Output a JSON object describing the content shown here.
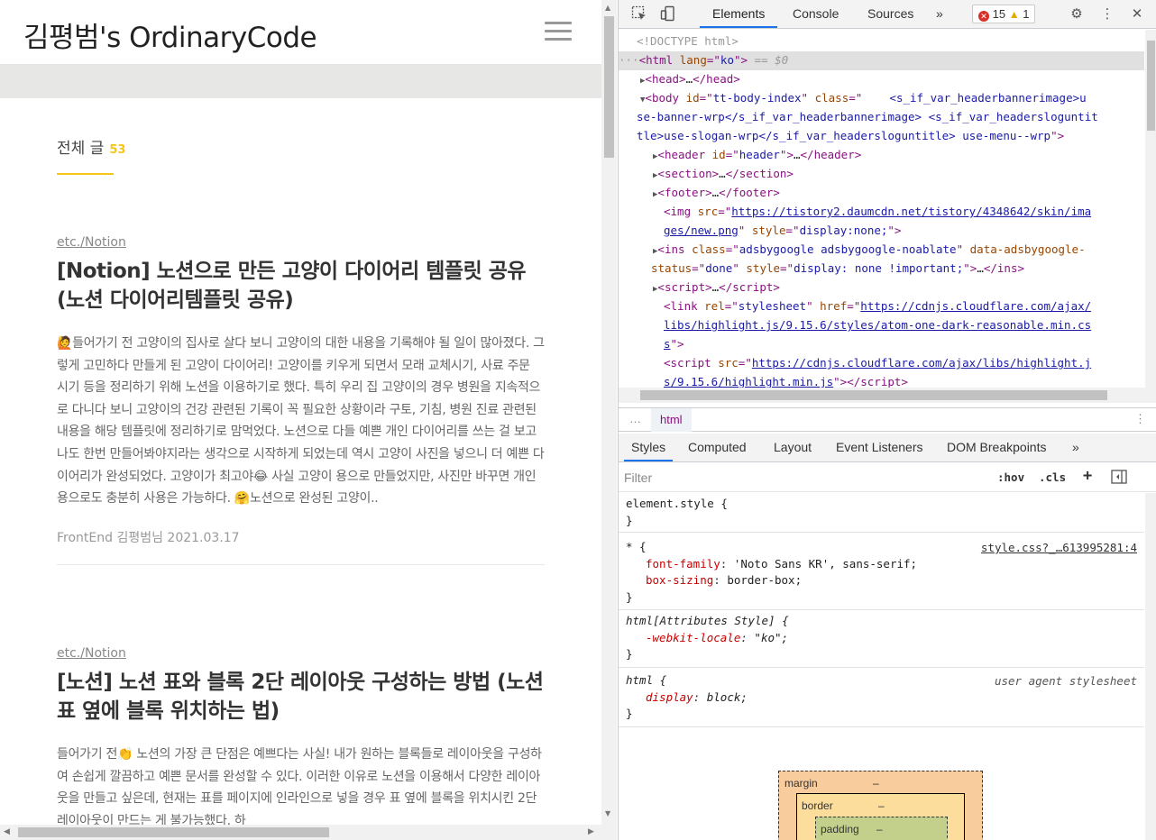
{
  "blog": {
    "title": "김평범's OrdinaryCode",
    "category_heading": "전체 글",
    "category_count": "53",
    "posts": [
      {
        "category": "etc./Notion",
        "title": "[Notion] 노션으로 만든 고양이 다이어리 템플릿 공유 (노션 다이어리템플릿 공유)",
        "body": "들어가기 전 고양이의 집사로 살다 보니 고양이의 대한 내용을 기록해야 될 일이 많아졌다. 그렇게 고민하다 만들게 된 고양이 다이어리! 고양이를 키우게 되면서 모래 교체시기, 사료 주문 시기 등을 정리하기 위해 노션을 이용하기로 했다. 특히 우리 집 고양이의 경우 병원을 지속적으로 다니다 보니 고양이의 건강 관련된 기록이 꼭 필요한 상황이라 구토, 기침, 병원 진료 관련된 내용을 해당 템플릿에 정리하기로 맘먹었다. 노션으로 다들 예쁜 개인 다이어리를 쓰는 걸 보고 나도 한번 만들어봐야지라는 생각으로 시작하게 되었는데 역시 고양이 사진을 넣으니 더 예쁜 다이어리가 완성되었다. 고양이가 최고야",
        "body_tail": " 사실 고양이 용으로 만들었지만, 사진만 바꾸면 개인용으로도 충분히 사용은 가능하다. ",
        "body_end": "노션으로 완성된 고양이..",
        "meta": "FrontEnd 김평범님 2021.03.17"
      },
      {
        "category": "etc./Notion",
        "title": "[노션] 노션 표와 블록 2단 레이아웃 구성하는 방법 (노션 표 옆에 블록 위치하는 법)",
        "body_start": "들어가기 전",
        "body": " 노션의 가장 큰 단점은 예쁘다는 사실! 내가 원하는 블록들로 레이아웃을 구성하여 손쉽게 깔끔하고 예쁜 문서를 완성할 수 있다. 이러한 이유로 노션을 이용해서 다양한 레이아웃을 만들고 싶은데, 현재는 표를 페이지에 인라인으로 넣을 경우 표 옆에 블록을 위치시킨 2단 레이아웃이 만드는 게 불가능했다. 하"
      }
    ]
  },
  "devtools": {
    "tabs": [
      "Elements",
      "Console",
      "Sources"
    ],
    "more_tabs": "»",
    "errors": "15",
    "warnings": "1",
    "dom": {
      "doctype": "<!DOCTYPE html>",
      "html_open": "html",
      "html_attr": "lang",
      "html_val": "ko",
      "html_suffix": " == $0",
      "head": "head",
      "body_id": "tt-body-index",
      "body_class_1": "    <s_if_var_headerbannerimage>u",
      "body_class_2": "se-banner-wrp</s_if_var_headerbannerimage> <s_if_var_headersloguntit",
      "body_class_3": "tle>use-slogan-wrp</s_if_var_headersloguntitle> use-menu--wrp",
      "header_id": "header",
      "img_src_1": "https://tistory2.daumcdn.net/tistory/4348642/skin/ima",
      "img_src_2": "ges/new.png",
      "img_style": "display:none;",
      "ins_class": "adsbygoogle adsbygoogle-noablate",
      "ins_attr": "data-adsbygoogle-",
      "ins_attr_2": "status",
      "ins_status": "done",
      "ins_style": "display: none !important;",
      "link_rel": "stylesheet",
      "link_href_1": "https://cdnjs.cloudflare.com/ajax/",
      "link_href_2": "libs/highlight.js/9.15.6/styles/atom-one-dark-reasonable.min.cs",
      "link_href_3": "s",
      "script_src_1": "https://cdnjs.cloudflare.com/ajax/libs/highlight.j",
      "script_src_2": "s/9.15.6/highlight.min.js"
    },
    "breadcrumb": "html",
    "sub_tabs": [
      "Styles",
      "Computed",
      "Layout",
      "Event Listeners",
      "DOM Breakpoints"
    ],
    "filter_placeholder": "Filter",
    "hov": ":hov",
    "cls": ".cls",
    "plus": "+",
    "rules": {
      "element_style": "element.style {",
      "universal_selector": "* {",
      "universal_source": "style.css?_…613995281:4",
      "font_family_name": "font-family",
      "font_family_value": "'Noto Sans KR', sans-serif;",
      "box_sizing_name": "box-sizing",
      "box_sizing_value": "border-box;",
      "attr_style_selector": "html[Attributes Style] {",
      "locale_name": "-webkit-locale",
      "locale_value": "\"ko\";",
      "html_selector": "html {",
      "ua_source": "user agent stylesheet",
      "display_name": "display",
      "display_value": "block;",
      "close": "}"
    },
    "box_model": {
      "margin": "margin",
      "border": "border",
      "padding": "padding",
      "dash": "–"
    }
  },
  "colors": {
    "accent": "#f5c518",
    "devtools_active_tab": "#1a73e8"
  }
}
